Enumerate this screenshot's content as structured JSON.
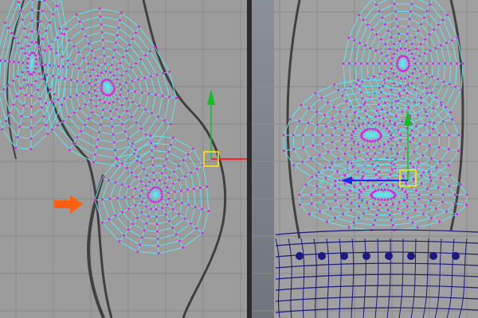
{
  "colors": {
    "viewport_bg": "#9c9c9c",
    "grid": "#8a8a8a",
    "wire": "#5fe6f0",
    "vertex": "#e020e0",
    "outline": "#222222",
    "pants_wire": "#1a1a80",
    "manip_y": "#10c020",
    "manip_x": "#ff2020",
    "manip_z": "#2020ff",
    "manip_center": "#ffee00",
    "arrow": "#ff6010"
  },
  "icons": [
    "move-manipulator-icon",
    "orange-arrow-icon"
  ]
}
